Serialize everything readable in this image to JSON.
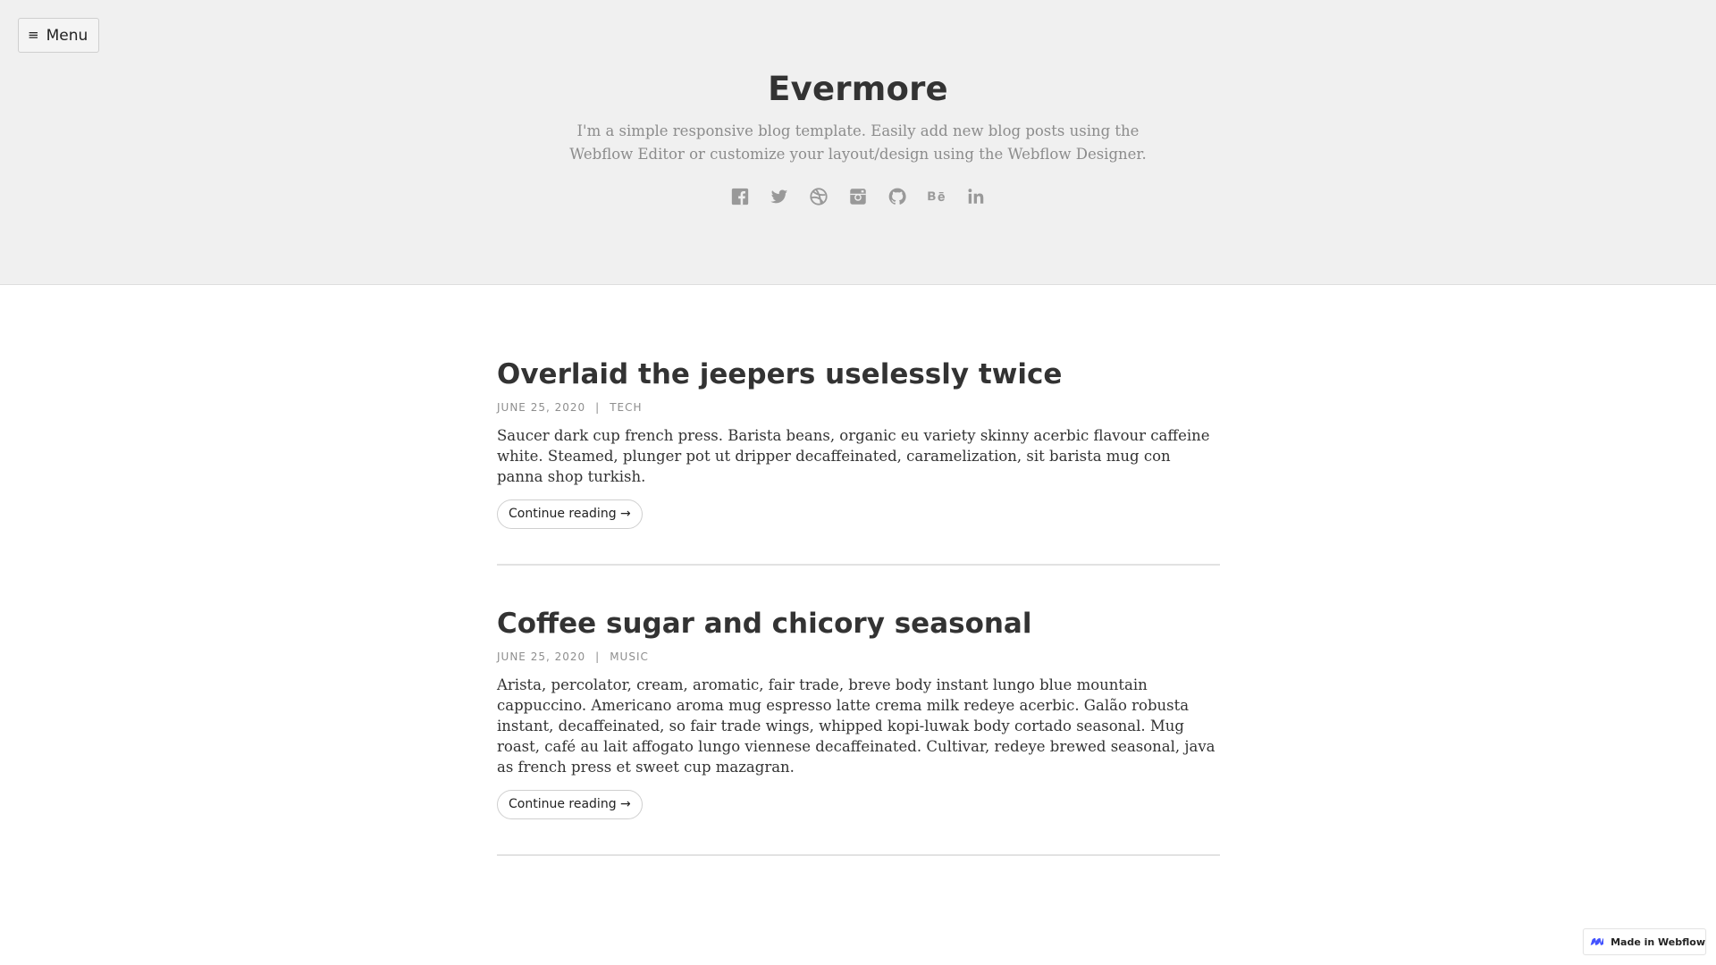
{
  "header": {
    "menu_label": "Menu",
    "menu_icon": "hamburger-icon",
    "title": "Evermore",
    "description": "I'm a simple responsive blog template. Easily add new blog posts using the Webflow Editor or customize your layout/design using the Webflow Designer.",
    "social_icons": [
      "facebook-icon",
      "twitter-icon",
      "dribbble-icon",
      "instagram-icon",
      "github-icon",
      "behance-icon",
      "linkedin-icon"
    ]
  },
  "posts": [
    {
      "title": "Overlaid the jeepers uselessly twice",
      "date": "JUNE 25, 2020",
      "separator": "|",
      "category": "TECH",
      "excerpt": "Saucer dark cup french press. Barista beans, organic eu variety skinny acerbic flavour caffeine white. Steamed, plunger pot ut dripper decaffeinated, caramelization, sit barista mug con panna shop turkish.",
      "read_more": "Continue reading →"
    },
    {
      "title": "Coffee sugar and chicory seasonal",
      "date": "JUNE 25, 2020",
      "separator": "|",
      "category": "MUSIC",
      "excerpt": "Arista, percolator, cream, aromatic, fair trade, breve body instant lungo blue mountain cappuccino. Americano aroma mug espresso latte crema milk redeye acerbic. Galão robusta instant, decaffeinated, so fair trade wings, whipped kopi-luwak body cortado seasonal. Mug roast, café au lait affogato lungo viennese decaffeinated. Cultivar, redeye brewed seasonal, java as french press et sweet cup mazagran.",
      "read_more": "Continue reading →"
    }
  ],
  "badge": {
    "label": "Made in Webflow",
    "icon": "webflow-logo-icon"
  },
  "colors": {
    "hero_background": "#f0f0f0",
    "title_text": "#333333",
    "muted_text": "#8c8c8c",
    "icon_gray": "#999999",
    "webflow_blue": "#4353ff"
  }
}
